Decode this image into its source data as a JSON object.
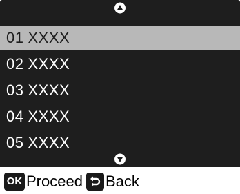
{
  "menu": {
    "items": [
      {
        "number": "01",
        "label": "XXXX",
        "selected": true
      },
      {
        "number": "02",
        "label": "XXXX",
        "selected": false
      },
      {
        "number": "03",
        "label": "XXXX",
        "selected": false
      },
      {
        "number": "04",
        "label": "XXXX",
        "selected": false
      },
      {
        "number": "05",
        "label": "XXXX",
        "selected": false
      }
    ],
    "scroll_up_icon": "triangle-up-circle-icon",
    "scroll_down_icon": "triangle-down-circle-icon"
  },
  "footer": {
    "ok_key": "OK",
    "proceed_label": "Proceed",
    "back_key_icon": "return-arrow-icon",
    "back_label": "Back"
  },
  "colors": {
    "panel_background": "#1e1e1e",
    "selected_row": "#b8b8b8",
    "text_light": "#ffffff",
    "footer_text": "#000000"
  }
}
